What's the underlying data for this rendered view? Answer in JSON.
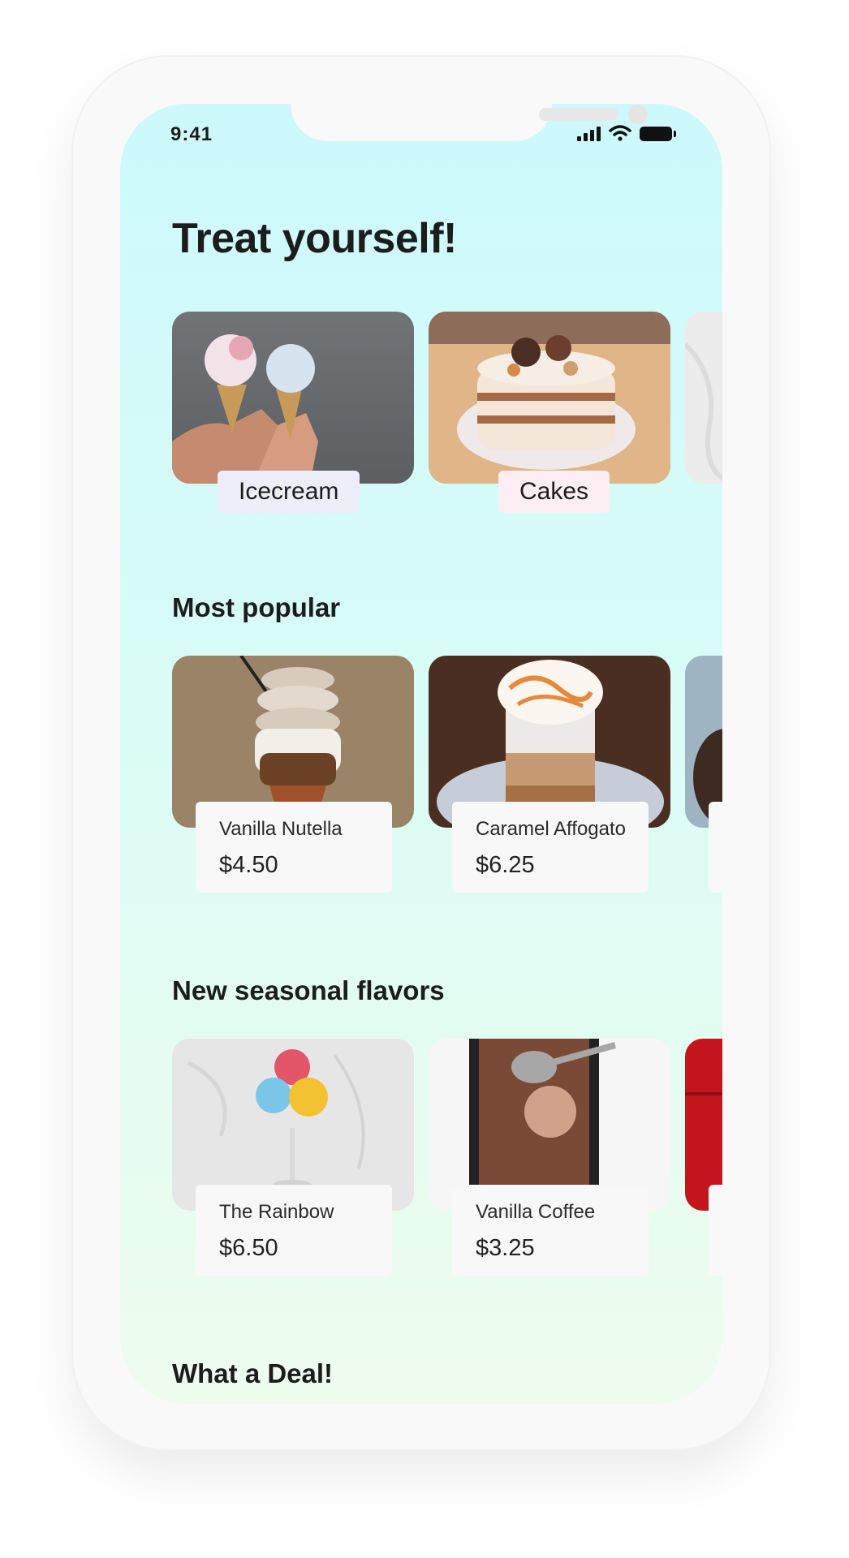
{
  "status_bar": {
    "time": "9:41"
  },
  "header": {
    "title": "Treat yourself!"
  },
  "categories": [
    {
      "label": "Icecream",
      "tag_color": "#eeeefb"
    },
    {
      "label": "Cakes",
      "tag_color": "#fdeef3"
    }
  ],
  "sections": {
    "popular": {
      "title": "Most popular",
      "items": [
        {
          "name": "Vanilla Nutella",
          "price": "$4.50"
        },
        {
          "name": "Caramel Affogato",
          "price": "$6.25"
        }
      ]
    },
    "seasonal": {
      "title": "New seasonal flavors",
      "items": [
        {
          "name": "The Rainbow",
          "price": "$6.50"
        },
        {
          "name": "Vanilla Coffee",
          "price": "$3.25"
        }
      ]
    },
    "deal": {
      "title": "What a Deal!"
    }
  },
  "colors": {
    "screen_top": "#cdf9fc",
    "screen_bottom": "#eefcee",
    "text": "#1c1c1c"
  }
}
